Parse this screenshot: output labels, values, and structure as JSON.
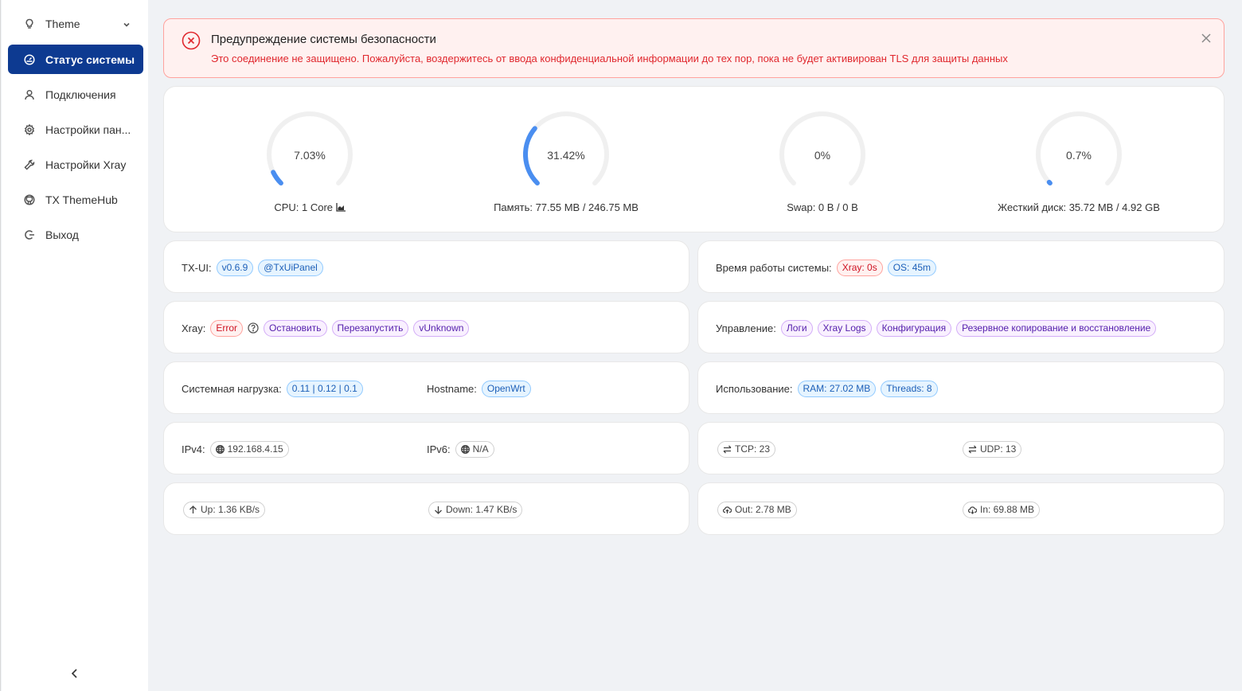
{
  "sidebar": {
    "theme_label": "Theme",
    "items": [
      {
        "label": "Статус системы",
        "icon": "dashboard-icon"
      },
      {
        "label": "Подключения",
        "icon": "user-icon"
      },
      {
        "label": "Настройки пан...",
        "icon": "gear-icon"
      },
      {
        "label": "Настройки Xray",
        "icon": "wrench-icon"
      },
      {
        "label": "TX ThemeHub",
        "icon": "github-icon"
      },
      {
        "label": "Выход",
        "icon": "logout-icon"
      }
    ]
  },
  "alert": {
    "title": "Предупреждение системы безопасности",
    "message": "Это соединение не защищено. Пожалуйста, воздержитесь от ввода конфиденциальной информации до тех пор, пока не будет активирован TLS для защиты данных"
  },
  "gauges": {
    "cpu": {
      "pct_text": "7.03%",
      "value": 7.03,
      "label": "CPU: 1 Core"
    },
    "mem": {
      "pct_text": "31.42%",
      "value": 31.42,
      "label": "Память: 77.55 MB / 246.75 MB"
    },
    "swap": {
      "pct_text": "0%",
      "value": 0,
      "label": "Swap: 0 B / 0 B"
    },
    "disk": {
      "pct_text": "0.7%",
      "value": 0.7,
      "label": "Жесткий диск: 35.72 MB / 4.92 GB"
    }
  },
  "txui": {
    "label": "TX-UI:",
    "version": "v0.6.9",
    "channel": "@TxUiPanel"
  },
  "uptime": {
    "label": "Время работы системы:",
    "xray": "Xray: 0s",
    "os": "OS: 45m"
  },
  "xray": {
    "label": "Xray:",
    "status": "Error",
    "stop": "Остановить",
    "restart": "Перезапустить",
    "version": "vUnknown"
  },
  "manage": {
    "label": "Управление:",
    "logs": "Логи",
    "xray_logs": "Xray Logs",
    "config": "Конфигурация",
    "backup": "Резервное копирование и восстановление"
  },
  "load": {
    "label": "Системная нагрузка:",
    "value": "0.11 | 0.12 | 0.1"
  },
  "hostname": {
    "label": "Hostname:",
    "value": "OpenWrt"
  },
  "usage": {
    "label": "Использование:",
    "ram": "RAM: 27.02 MB",
    "threads": "Threads: 8"
  },
  "ipv4": {
    "label": "IPv4:",
    "value": "192.168.4.15"
  },
  "ipv6": {
    "label": "IPv6:",
    "value": "N/A"
  },
  "tcp": {
    "value": "TCP: 23"
  },
  "udp": {
    "value": "UDP: 13"
  },
  "up": {
    "value": "Up: 1.36 KB/s"
  },
  "down": {
    "value": "Down: 1.47 KB/s"
  },
  "out": {
    "value": "Out: 2.78 MB"
  },
  "in": {
    "value": "In: 69.88 MB"
  },
  "colors": {
    "accent": "#0d3a91",
    "gauge": "#4a8ef0",
    "gauge_track": "#f0f0f0",
    "danger": "#e0282e"
  }
}
